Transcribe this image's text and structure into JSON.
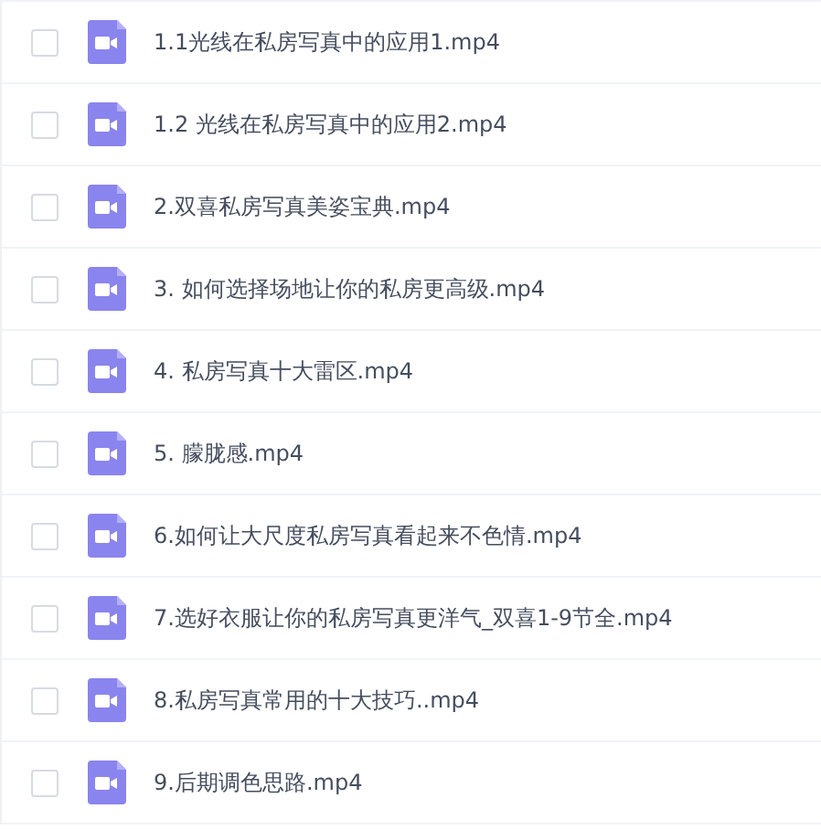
{
  "files": [
    {
      "name": "1.1光线在私房写真中的应用1.mp4",
      "checked": false
    },
    {
      "name": "1.2 光线在私房写真中的应用2.mp4",
      "checked": false
    },
    {
      "name": "2.双喜私房写真美姿宝典.mp4",
      "checked": false
    },
    {
      "name": "3. 如何选择场地让你的私房更高级.mp4",
      "checked": false
    },
    {
      "name": "4. 私房写真十大雷区.mp4",
      "checked": false
    },
    {
      "name": "5. 朦胧感.mp4",
      "checked": false
    },
    {
      "name": "6.如何让大尺度私房写真看起来不色情.mp4",
      "checked": false
    },
    {
      "name": "7.选好衣服让你的私房写真更洋气_双喜1-9节全.mp4",
      "checked": false
    },
    {
      "name": "8.私房写真常用的十大技巧..mp4",
      "checked": false
    },
    {
      "name": "9.后期调色思路.mp4",
      "checked": false
    }
  ]
}
